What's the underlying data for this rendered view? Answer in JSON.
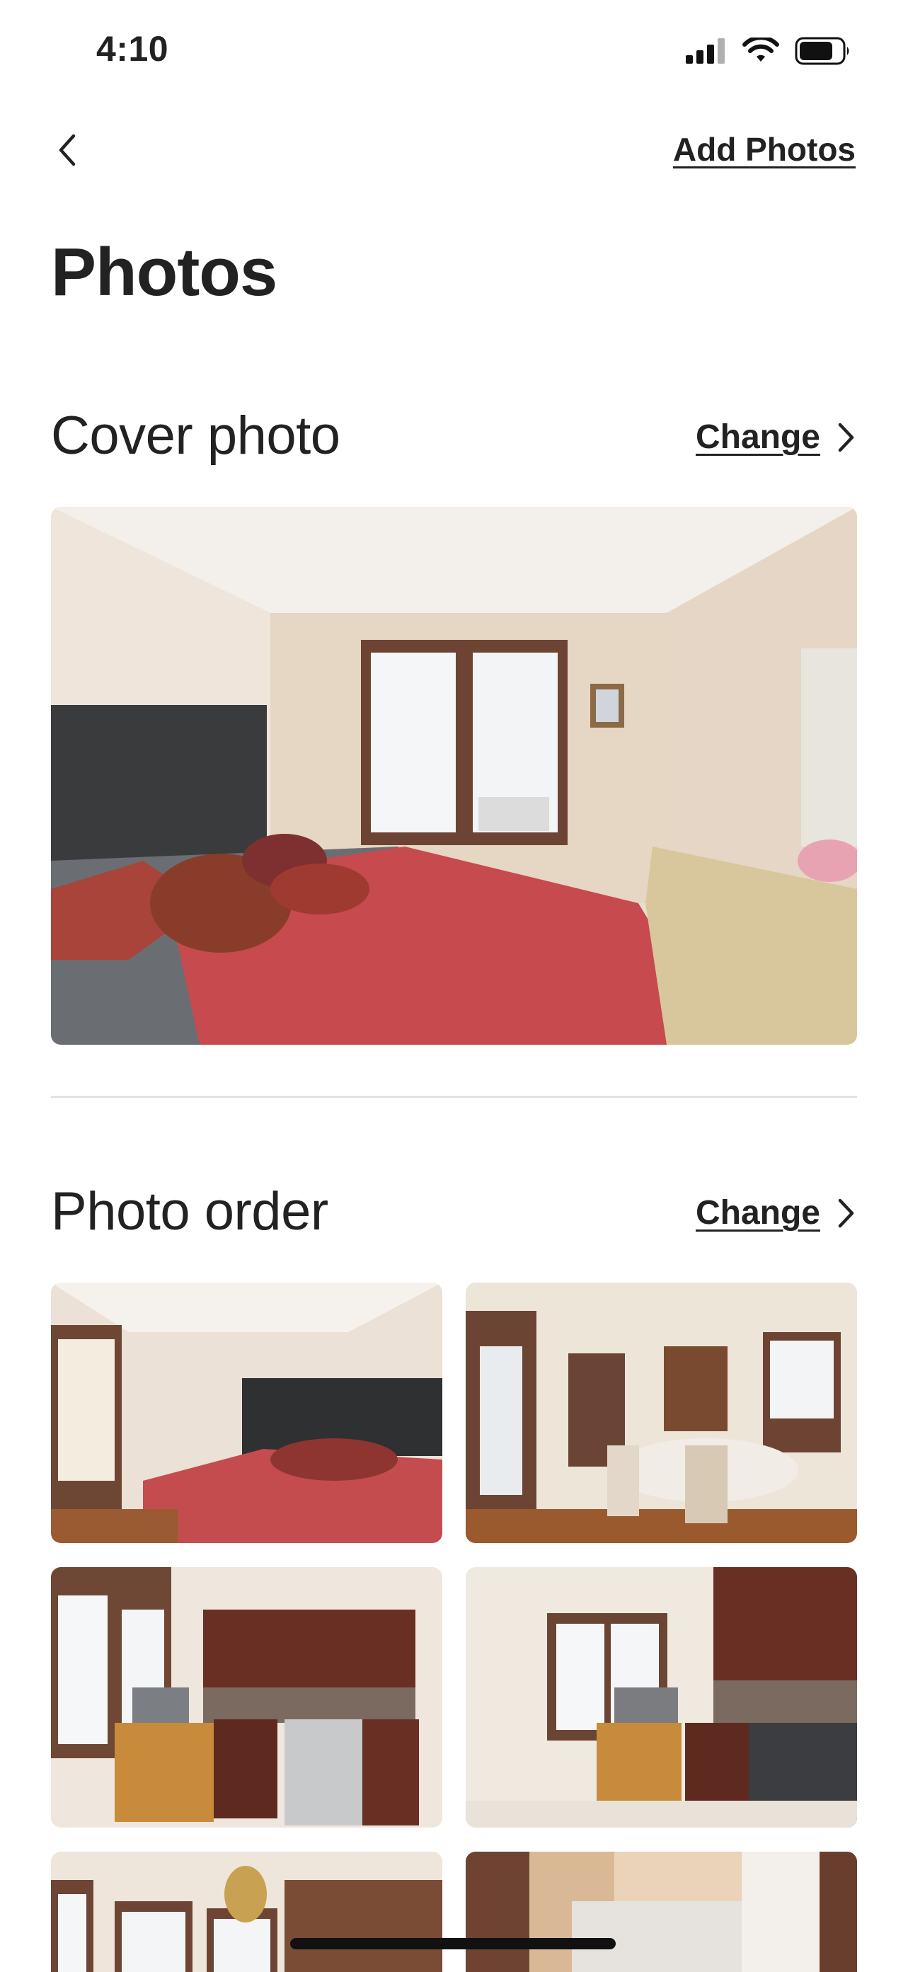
{
  "status_bar": {
    "time": "4:10",
    "icons": [
      "cellular-signal-icon",
      "wifi-icon",
      "battery-icon"
    ]
  },
  "header": {
    "back_icon": "chevron-left-icon",
    "add_photos_label": "Add Photos"
  },
  "page_title": "Photos",
  "cover_section": {
    "title": "Cover photo",
    "change_label": "Change",
    "change_icon": "chevron-right-icon",
    "photo": "bedroom with red quilted comforter, dark headboard and window"
  },
  "order_section": {
    "title": "Photo order",
    "change_label": "Change",
    "change_icon": "chevron-right-icon",
    "photos": [
      "bedroom with red comforter",
      "dining room with table and chairs",
      "kitchen with wood cabinets and stove",
      "kitchen with window and microwave",
      "sunroom with chandelier",
      "bathroom with shower"
    ]
  },
  "colors": {
    "text": "#222222",
    "divider": "#e3e3e3",
    "background": "#ffffff"
  }
}
